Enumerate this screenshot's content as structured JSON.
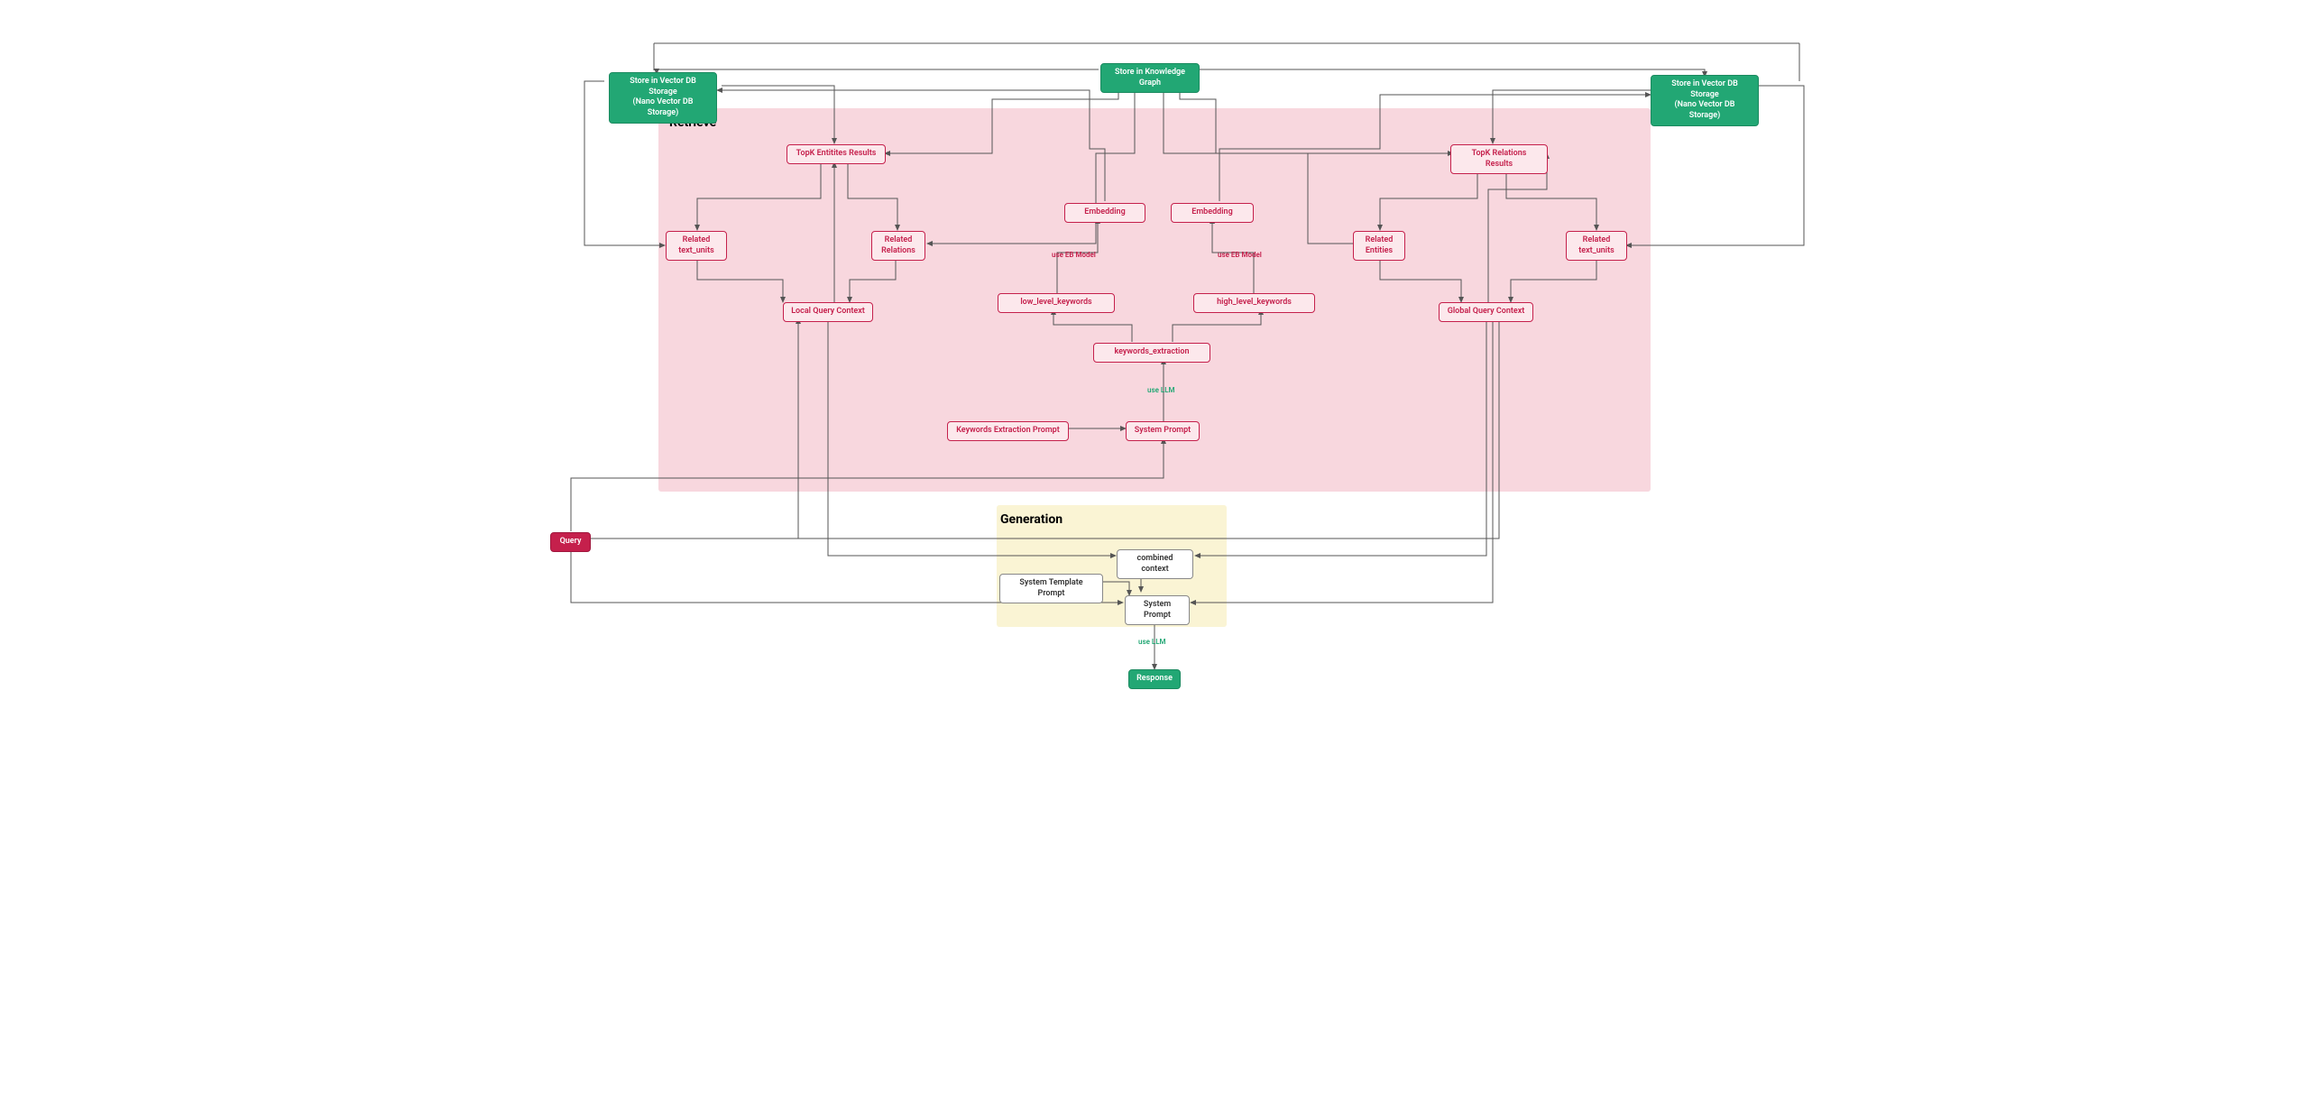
{
  "zones": {
    "retrieve": {
      "title": "Retrieve"
    },
    "generation": {
      "title": "Generation"
    }
  },
  "nodes": {
    "store_kg": "Store in Knowledge Graph",
    "store_vdb_left": "Store in Vector DB Storage\n(Nano Vector DB Storage)",
    "store_vdb_right": "Store in Vector DB Storage\n(Nano Vector DB Storage)",
    "topk_entities": "TopK Entitites Results",
    "topk_relations": "TopK Relations Results",
    "related_text_units_l": "Related\ntext_units",
    "related_relations": "Related\nRelations",
    "related_entities": "Related\nEntities",
    "related_text_units_r": "Related\ntext_units",
    "embedding_l": "Embedding",
    "embedding_r": "Embedding",
    "low_kw": "low_level_keywords",
    "high_kw": "high_level_keywords",
    "local_qc": "Local Query Context",
    "global_qc": "Global Query Context",
    "kw_extraction": "keywords_extraction",
    "kw_prompt": "Keywords Extraction Prompt",
    "sys_prompt_retrieve": "System Prompt",
    "sys_tmpl_prompt": "System Template Prompt",
    "combined_context": "combined context",
    "sys_prompt_gen": "System Prompt",
    "query": "Query",
    "response": "Response"
  },
  "edge_labels": {
    "use_eb_l": "use  EB Model",
    "use_eb_r": "use  EB Model",
    "use_llm_kw": "use LLM",
    "use_llm_resp": "use LLM"
  }
}
